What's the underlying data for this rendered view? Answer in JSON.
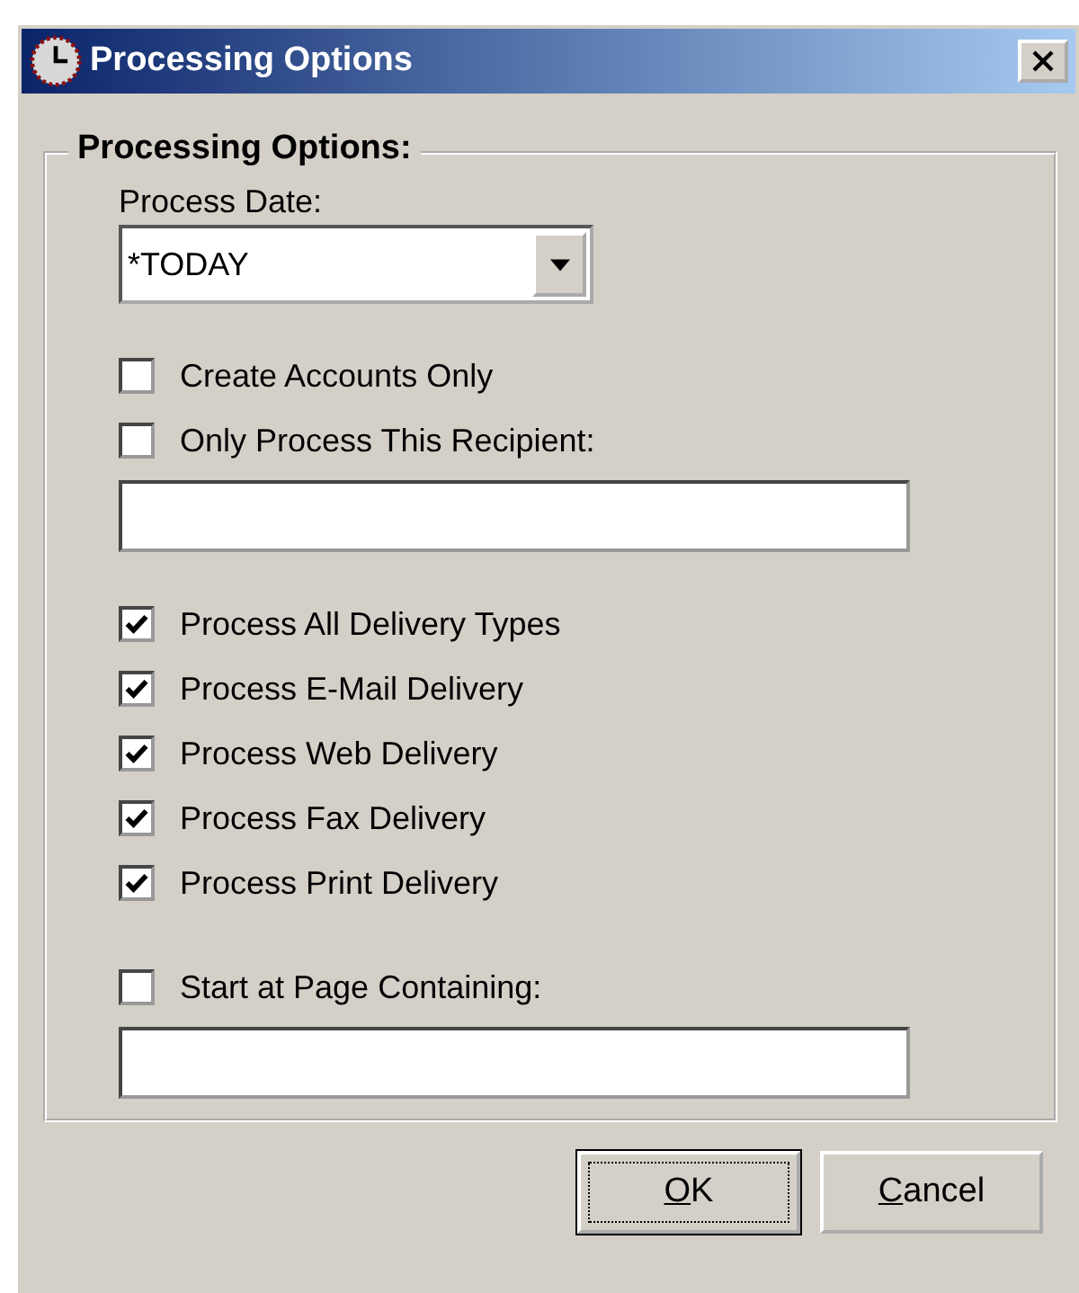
{
  "window": {
    "title": "Processing Options"
  },
  "group": {
    "label": "Processing Options:",
    "process_date": {
      "label": "Process Date:",
      "value": "*TODAY"
    },
    "sections": [
      [
        {
          "kind": "checkbox",
          "label": "Create Accounts Only",
          "checked": false
        },
        {
          "kind": "checkbox",
          "label": "Only Process This Recipient:",
          "checked": false
        },
        {
          "kind": "field"
        }
      ],
      [
        {
          "kind": "checkbox",
          "label": "Process All Delivery Types",
          "checked": true
        },
        {
          "kind": "checkbox",
          "label": "Process E-Mail Delivery",
          "checked": true
        },
        {
          "kind": "checkbox",
          "label": "Process Web Delivery",
          "checked": true
        },
        {
          "kind": "checkbox",
          "label": "Process Fax Delivery",
          "checked": true
        },
        {
          "kind": "checkbox",
          "label": "Process Print Delivery",
          "checked": true
        }
      ],
      [
        {
          "kind": "checkbox",
          "label": "Start at Page Containing:",
          "checked": false
        },
        {
          "kind": "field"
        }
      ]
    ]
  },
  "buttons": [
    {
      "access_key": "O",
      "rest": "K",
      "default": true
    },
    {
      "access_key": "C",
      "rest": "ancel",
      "default": false
    }
  ]
}
